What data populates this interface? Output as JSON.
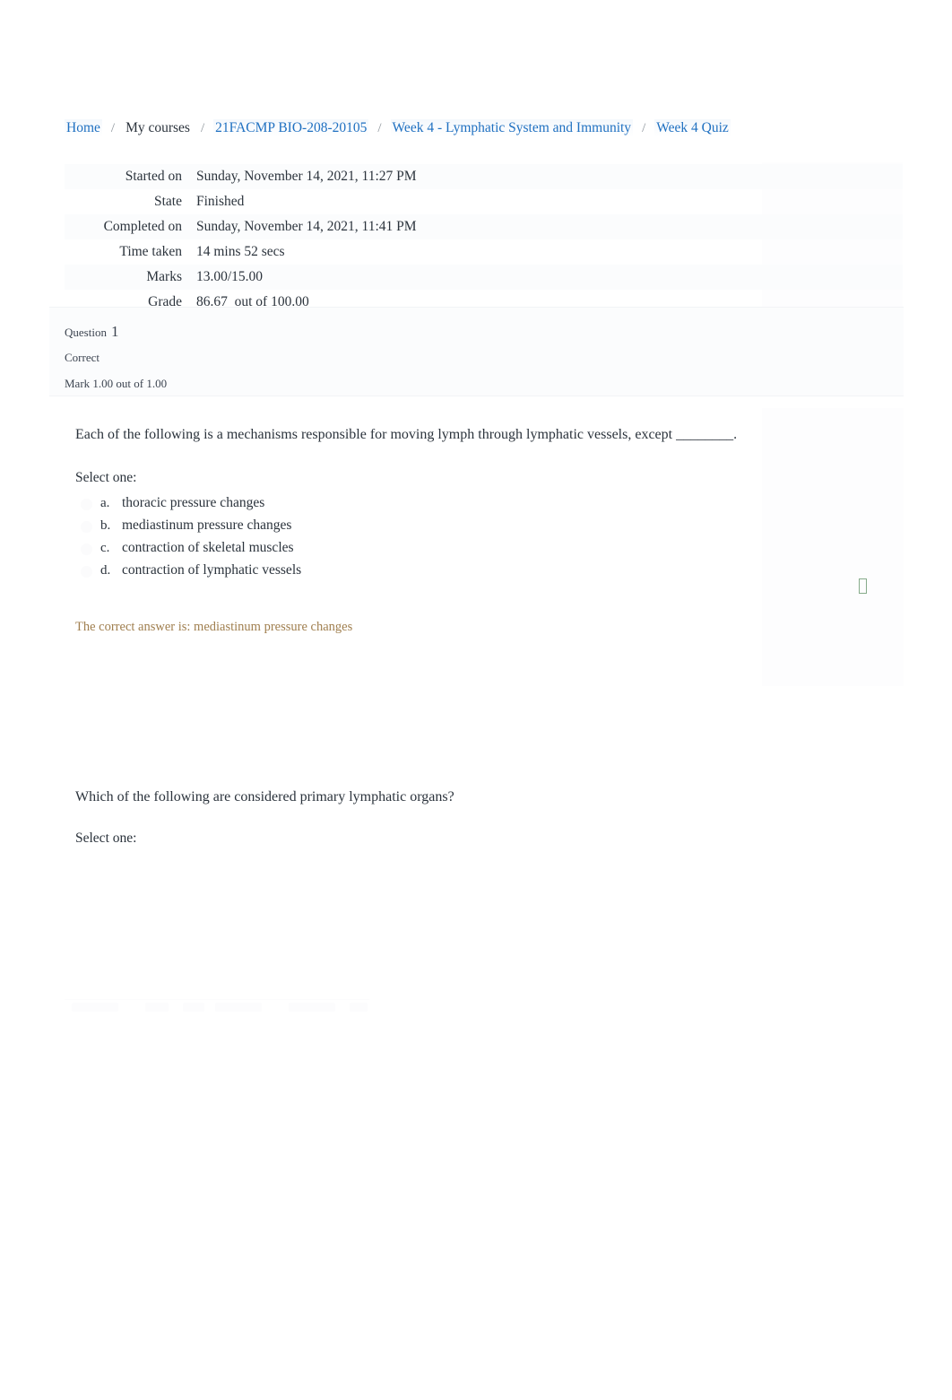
{
  "breadcrumb": {
    "separator": "/",
    "items": [
      {
        "label": "Home",
        "type": "link"
      },
      {
        "label": "My courses",
        "type": "text"
      },
      {
        "label": "21FACMP BIO-208-20105",
        "type": "link"
      },
      {
        "label": "Week 4 - Lymphatic System and Immunity",
        "type": "link"
      },
      {
        "label": "Week 4 Quiz",
        "type": "link"
      }
    ]
  },
  "quiz_summary": {
    "rows": [
      {
        "label": "Started on",
        "value": "Sunday, November 14, 2021, 11:27 PM"
      },
      {
        "label": "State",
        "value": "Finished"
      },
      {
        "label": "Completed on",
        "value": "Sunday, November 14, 2021, 11:41 PM"
      },
      {
        "label": "Time taken",
        "value": "14 mins 52 secs"
      },
      {
        "label": "Marks",
        "value": "13.00/15.00"
      },
      {
        "label": "Grade",
        "value": "86.67  out of 100.00"
      }
    ]
  },
  "question1": {
    "header": {
      "question_word": "Question",
      "number": "1",
      "state": "Correct",
      "grade": "Mark 1.00 out of 1.00"
    },
    "text": "Each of the following is a mechanisms responsible for moving lymph through lymphatic vessels, except ________.",
    "select_prompt": "Select one:",
    "options": [
      {
        "letter": "a.",
        "label": "thoracic pressure changes"
      },
      {
        "letter": "b.",
        "label": "mediastinum pressure changes"
      },
      {
        "letter": "c.",
        "label": "contraction of skeletal muscles"
      },
      {
        "letter": "d.",
        "label": "contraction of lymphatic vessels"
      }
    ],
    "feedback": "The correct answer is: mediastinum pressure changes",
    "flag_icon": "flag-icon"
  },
  "question2": {
    "text": "Which of the following are considered primary lymphatic organs?",
    "select_prompt": "Select one:"
  },
  "colors": {
    "link": "#1f70c1",
    "text": "#2b333c",
    "feedback": "#a07f4f",
    "panel_bg": "#fbfcfd",
    "flag_outline": "#86ab8a"
  }
}
